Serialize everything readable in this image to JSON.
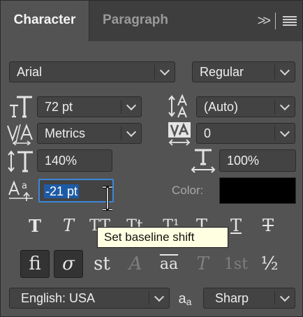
{
  "tabs": {
    "active": "Character",
    "inactive": "Paragraph"
  },
  "font": {
    "family": "Arial",
    "style": "Regular"
  },
  "size": {
    "font_size": "72 pt",
    "leading": "(Auto)"
  },
  "spacing": {
    "kerning": "Metrics",
    "tracking": "0"
  },
  "scale": {
    "vertical": "140%",
    "horizontal": "100%"
  },
  "baseline": {
    "value": "-21 pt"
  },
  "color": {
    "label": "Color:",
    "swatch": "#000000"
  },
  "tooltip": {
    "text": "Set baseline shift"
  },
  "type_styles": [
    "T",
    "T",
    "TT",
    "Tt",
    "T¹",
    "T",
    "T",
    "T"
  ],
  "opentype": [
    "fi",
    "σ",
    "st",
    "A",
    "aa",
    "T",
    "1st",
    "½"
  ],
  "footer": {
    "language": "English: USA",
    "aa_glyph": "a",
    "aa_glyph_sub": "a",
    "antialias": "Sharp"
  },
  "colors": {
    "panel_bg": "#535353",
    "tab_bar": "#3e3e3e",
    "field_bg": "#434343",
    "selection": "#1e5ba6",
    "focus": "#3b86d8",
    "tooltip_bg": "#ffffe1"
  },
  "icons": [
    "chevrons-right-icon",
    "panel-menu-icon",
    "font-size-icon",
    "leading-icon",
    "kerning-icon",
    "tracking-icon",
    "vertical-scale-icon",
    "horizontal-scale-icon",
    "baseline-shift-icon",
    "anti-alias-icon"
  ]
}
